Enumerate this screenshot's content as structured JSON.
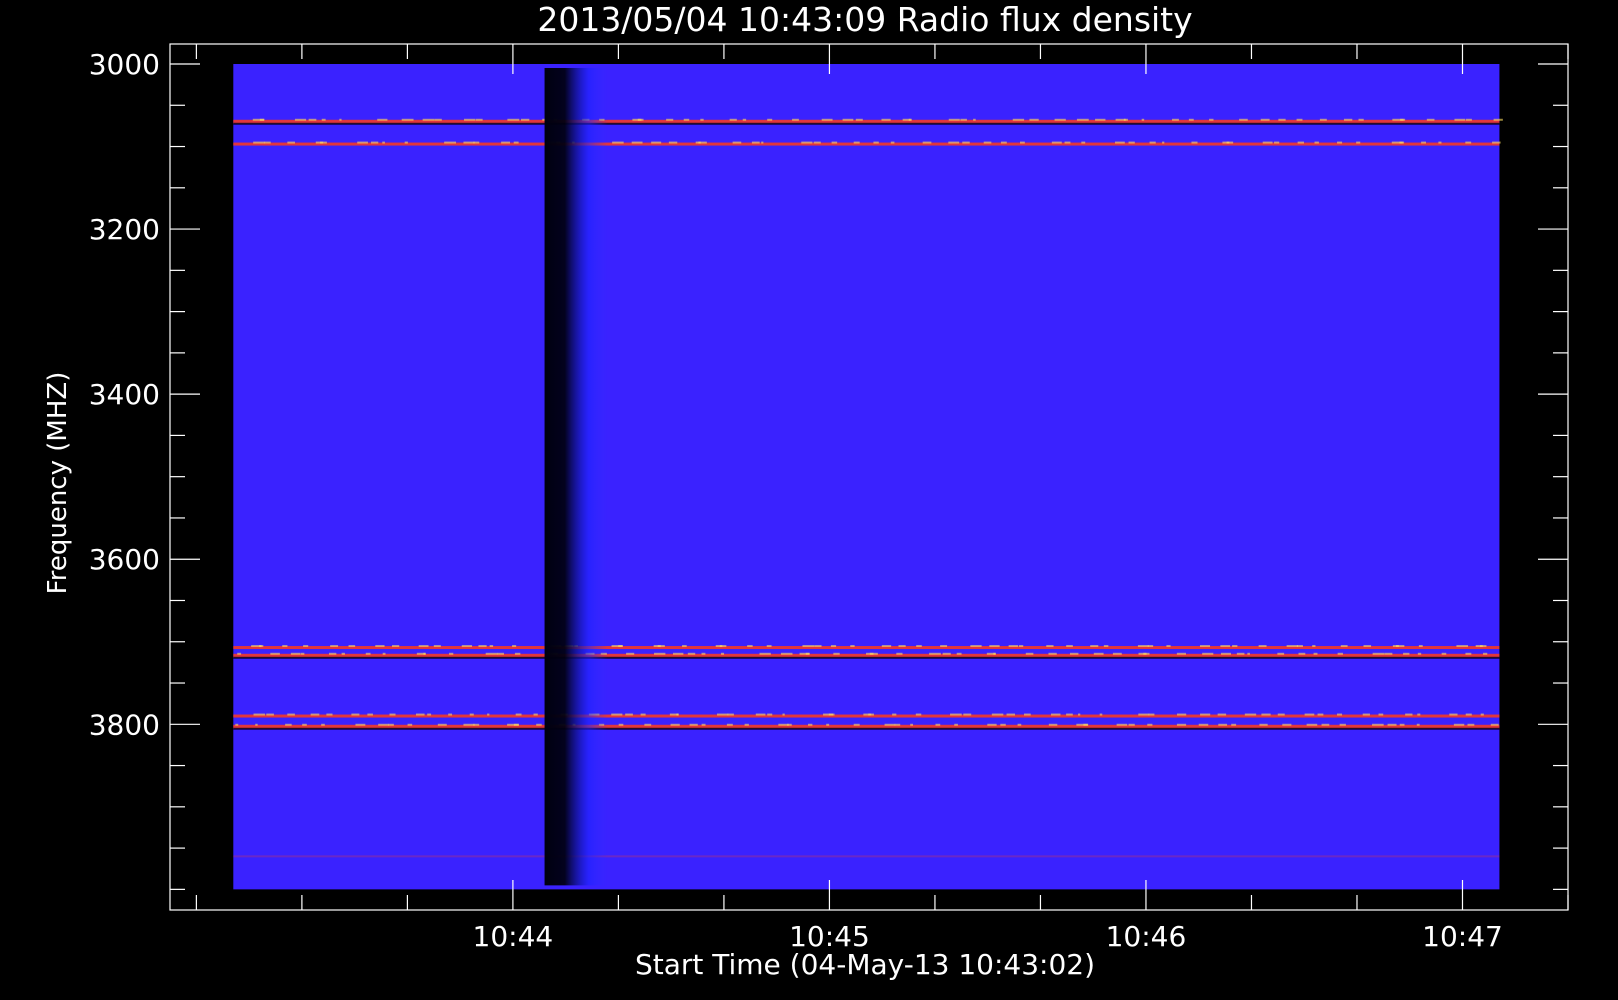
{
  "chart_data": {
    "type": "heatmap",
    "title": "2013/05/04 10:43:09 Radio flux density",
    "xlabel": "Start Time (04-May-13 10:43:02)",
    "ylabel": "Frequency (MHZ)",
    "x_ticks": [
      {
        "label": "10:44",
        "t": 60
      },
      {
        "label": "10:45",
        "t": 120
      },
      {
        "label": "10:46",
        "t": 180
      },
      {
        "label": "10:47",
        "t": 240
      }
    ],
    "x_minor_step": 20,
    "xlim": [
      -5,
      260
    ],
    "y_ticks": [
      3000,
      3200,
      3400,
      3600,
      3800
    ],
    "y_minor_step": 50,
    "ylim": [
      3000,
      4025
    ],
    "data_extent": {
      "t_start": 7,
      "t_end": 247,
      "freq_start": 3000,
      "freq_end": 4000
    },
    "colors": {
      "background": "#000000",
      "base": "#3a22ff",
      "axis": "#ffffff",
      "line_hot": "#ff3a1a",
      "line_peak": "#ffe060",
      "line_dark": "#050018"
    },
    "dark_band": {
      "t_start": 66,
      "t_core_end": 70,
      "t_fade_end": 78
    },
    "rfi_lines": [
      {
        "freq": 3070,
        "kind": "bright"
      },
      {
        "freq": 3097,
        "kind": "hot"
      },
      {
        "freq": 3707,
        "kind": "hot"
      },
      {
        "freq": 3717,
        "kind": "bright"
      },
      {
        "freq": 3790,
        "kind": "hot"
      },
      {
        "freq": 3803,
        "kind": "bright"
      },
      {
        "freq": 3960,
        "kind": "faint"
      }
    ]
  }
}
